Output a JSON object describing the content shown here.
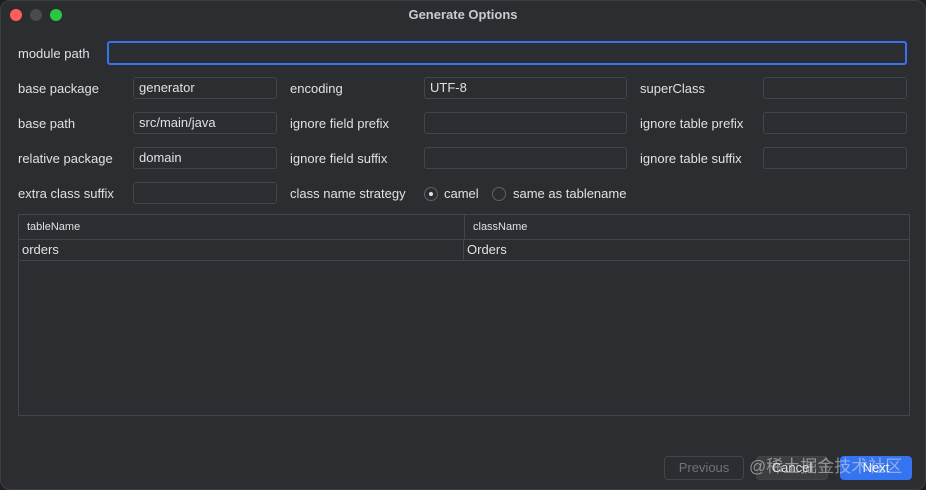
{
  "window": {
    "title": "Generate Options"
  },
  "colors": {
    "accent": "#3574f0",
    "close": "#ff5f57",
    "maximize": "#28c840",
    "background": "#2b2d30"
  },
  "form": {
    "module_path": {
      "label": "module path",
      "value": ""
    },
    "base_package": {
      "label": "base package",
      "value": "generator"
    },
    "encoding": {
      "label": "encoding",
      "value": "UTF-8"
    },
    "super_class": {
      "label": "superClass",
      "value": ""
    },
    "base_path": {
      "label": "base path",
      "value": "src/main/java"
    },
    "ignore_field_prefix": {
      "label": "ignore field prefix",
      "value": ""
    },
    "ignore_table_prefix": {
      "label": "ignore table prefix",
      "value": ""
    },
    "relative_package": {
      "label": "relative package",
      "value": "domain"
    },
    "ignore_field_suffix": {
      "label": "ignore field suffix",
      "value": ""
    },
    "ignore_table_suffix": {
      "label": "ignore table suffix",
      "value": ""
    },
    "extra_class_suffix": {
      "label": "extra class suffix",
      "value": ""
    },
    "class_name_strategy": {
      "label": "class name strategy",
      "options": [
        "camel",
        "same as tablename"
      ],
      "selected": "camel"
    }
  },
  "table": {
    "columns": [
      "tableName",
      "className"
    ],
    "rows": [
      [
        "orders",
        "Orders"
      ]
    ]
  },
  "buttons": {
    "previous": "Previous",
    "cancel": "Cancel",
    "next": "Next"
  },
  "watermark": "@稀土掘金技术社区"
}
